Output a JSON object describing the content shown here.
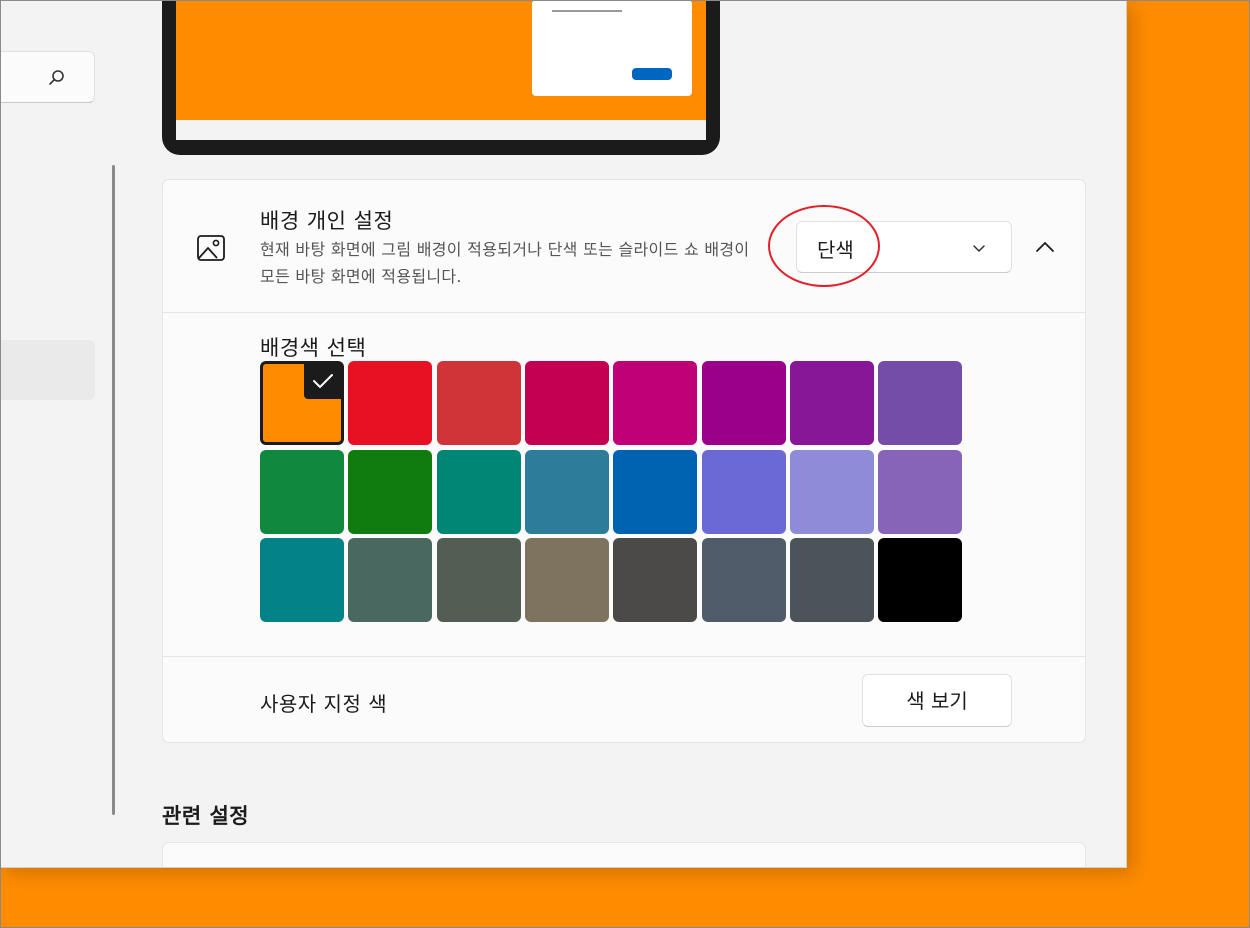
{
  "background_section": {
    "title": "배경 개인 설정",
    "description": "현재 바탕 화면에 그림 배경이 적용되거나 단색 또는 슬라이드 쇼 배경이 모든 바탕 화면에 적용됩니다.",
    "dropdown_value": "단색",
    "icon": "picture-icon"
  },
  "colors": {
    "title": "배경색 선택",
    "selected_index": 0,
    "swatches": [
      "#ff8c00",
      "#e81123",
      "#d13438",
      "#c30052",
      "#bf0077",
      "#9a0089",
      "#881798",
      "#744da9",
      "#10893e",
      "#107c10",
      "#018574",
      "#2d7d9a",
      "#0063b1",
      "#6b69d6",
      "#8e8cd8",
      "#8764b8",
      "#038387",
      "#486860",
      "#525e54",
      "#7e735f",
      "#4c4a48",
      "#515c6b",
      "#4a5459",
      "#000000"
    ]
  },
  "custom_color": {
    "label": "사용자 지정 색",
    "button_label": "색 보기"
  },
  "related": {
    "title": "관련 설정"
  },
  "theme": {
    "accent": "#ff8c00",
    "highlight": "#e0202a"
  }
}
